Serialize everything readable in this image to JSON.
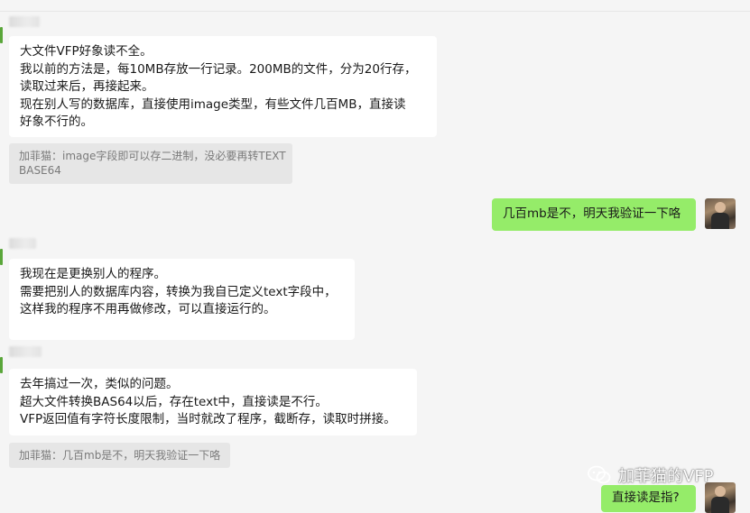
{
  "messages": [
    {
      "id": "m1",
      "side": "left",
      "lines": [
        "大文件VFP好象读不全。",
        "我以前的方法是，每10MB存放一行记录。200MB的文件，分为20行存，",
        "读取过来后，再接起来。",
        "现在别人写的数据库，直接使用image类型，有些文件几百MB，直接读",
        "好象不行的。"
      ],
      "quote_lines": [
        "加菲猫：image字段即可以存二进制，没必要再转TEXT",
        "BASE64"
      ]
    },
    {
      "id": "m2",
      "side": "right",
      "lines": [
        "几百mb是不，明天我验证一下咯"
      ]
    },
    {
      "id": "m3",
      "side": "left",
      "lines": [
        "我现在是更换别人的程序。",
        "需要把别人的数据库内容，转换为我自已定义text字段中，",
        "这样我的程序不用再做修改，可以直接运行的。"
      ]
    },
    {
      "id": "m4",
      "side": "left",
      "lines": [
        "去年搞过一次，类似的问题。",
        "超大文件转换BAS64以后，存在text中，直接读是不行。",
        "VFP返回值有字符长度限制，当时就改了程序，截断存，读取时拼接。"
      ],
      "quote_lines": [
        "加菲猫：几百mb是不，明天我验证一下咯"
      ]
    },
    {
      "id": "m5",
      "side": "right",
      "lines": [
        "直接读是指?"
      ]
    }
  ],
  "watermark": {
    "text": "加菲猫的VFP",
    "icon": "wechat-icon"
  },
  "colors": {
    "bg": "#f5f5f5",
    "incoming": "#ffffff",
    "outgoing": "#95ec69",
    "quote": "#e6e6e6"
  }
}
